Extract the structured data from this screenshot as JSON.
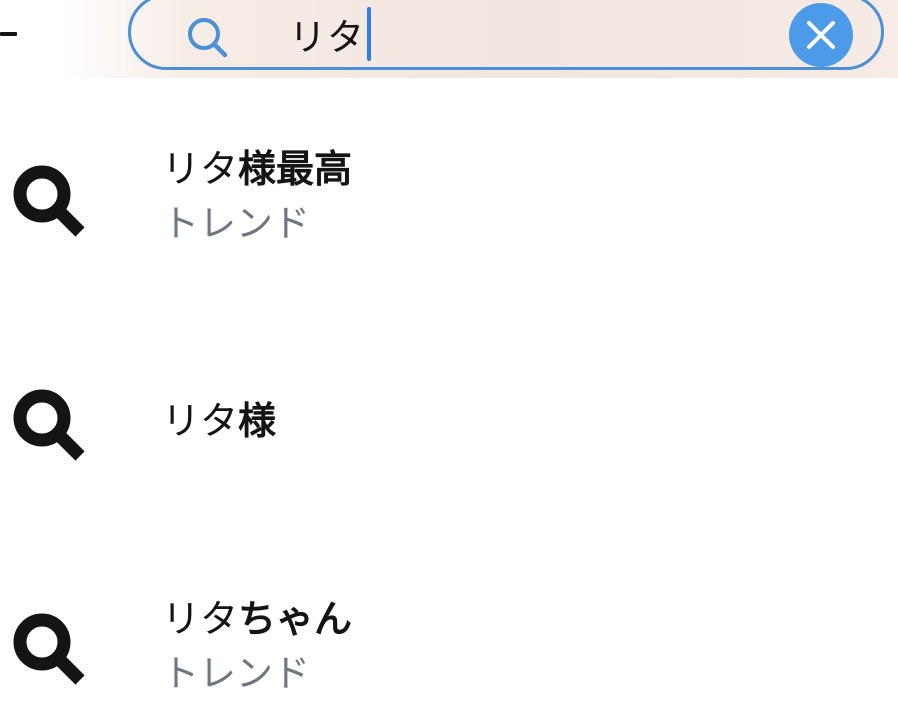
{
  "search": {
    "query": "リタ"
  },
  "suggestions": [
    {
      "prefix": "リタ",
      "bold": "様最高",
      "subtitle": "トレンド"
    },
    {
      "prefix": "リタ",
      "bold": "様",
      "subtitle": ""
    },
    {
      "prefix": "リタ",
      "bold": "ちゃん",
      "subtitle": "トレンド"
    }
  ],
  "colors": {
    "accent": "#4c9be8",
    "search_border": "#4a90d6",
    "caret": "#2f7fe0",
    "subtitle_text": "#6e7781",
    "icon": "#141414"
  },
  "icons": {
    "search_bar_icon": "search-icon",
    "clear_icon": "close-icon",
    "suggestion_icon": "search-icon"
  }
}
